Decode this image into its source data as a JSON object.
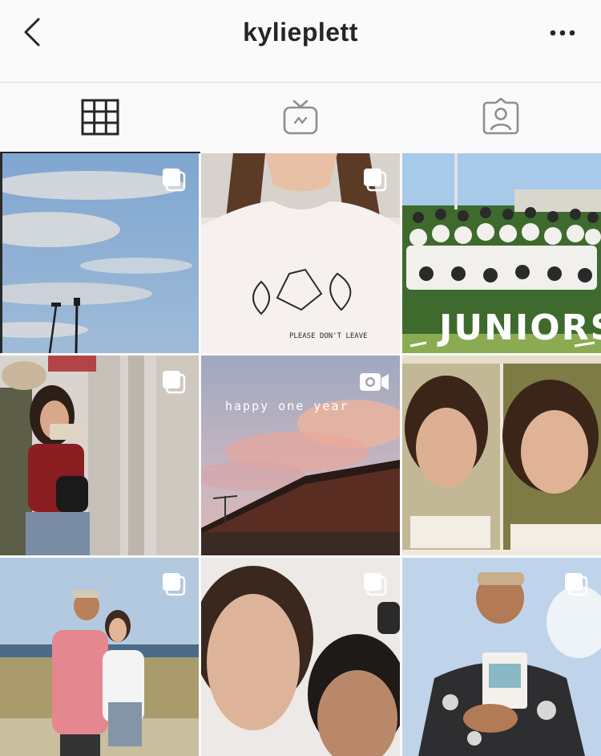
{
  "header": {
    "username": "kylieplett",
    "back_icon": "chevron-left-icon",
    "more_icon": "more-horizontal-icon"
  },
  "tabs": [
    {
      "name": "grid",
      "icon": "grid-icon",
      "active": true
    },
    {
      "name": "igtv",
      "icon": "igtv-icon",
      "active": false
    },
    {
      "name": "tagged",
      "icon": "tagged-user-icon",
      "active": false
    }
  ],
  "posts": [
    {
      "subject": "sky with clouds and light poles",
      "badge": "carousel-icon"
    },
    {
      "subject": "white tee with leaf print",
      "badge": "carousel-icon",
      "shirt_text": "PLEASE DON'T LEAVE"
    },
    {
      "subject": "group photo",
      "badge": "none",
      "overlay_text": "JUNIORS"
    },
    {
      "subject": "mirror selfie",
      "badge": "carousel-icon"
    },
    {
      "subject": "pink sunset sky over roof",
      "badge": "video-icon",
      "overlay_text": "happy  one  year"
    },
    {
      "subject": "two selfies side by side",
      "badge": "none"
    },
    {
      "subject": "couple at beach field",
      "badge": "carousel-icon"
    },
    {
      "subject": "close-up selfie of two faces",
      "badge": "carousel-icon"
    },
    {
      "subject": "guy in floral shirt holding book",
      "badge": "carousel-icon"
    }
  ],
  "colors": {
    "text": "#262626",
    "border": "#dbdbdb",
    "background": "#fafafa"
  }
}
